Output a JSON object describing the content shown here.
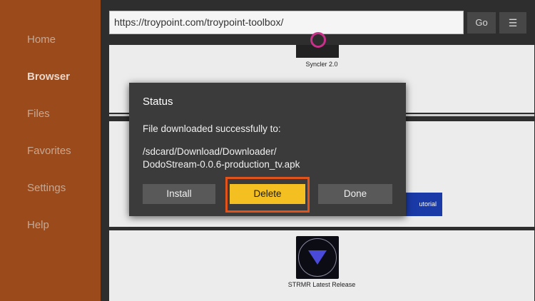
{
  "sidebar": {
    "items": [
      {
        "label": "Home",
        "active": false
      },
      {
        "label": "Browser",
        "active": true
      },
      {
        "label": "Files",
        "active": false
      },
      {
        "label": "Favorites",
        "active": false
      },
      {
        "label": "Settings",
        "active": false
      },
      {
        "label": "Help",
        "active": false
      }
    ]
  },
  "toolbar": {
    "url": "https://troypoint.com/troypoint-toolbox/",
    "go_label": "Go",
    "menu_icon": "☰"
  },
  "webpage": {
    "syncler_caption": "Syncler 2.0",
    "tutorial_label": "utorial",
    "strmr_caption": "STRMR Latest Release"
  },
  "dialog": {
    "title": "Status",
    "message": "File downloaded successfully to:",
    "path_line1": "/sdcard/Download/Downloader/",
    "path_line2": "DodoStream-0.0.6-production_tv.apk",
    "install_label": "Install",
    "delete_label": "Delete",
    "done_label": "Done"
  },
  "colors": {
    "sidebar": "#9a4a1b",
    "delete_button": "#f4bf20",
    "highlight": "#e0541b",
    "tutorial_button": "#1a3aa8"
  }
}
